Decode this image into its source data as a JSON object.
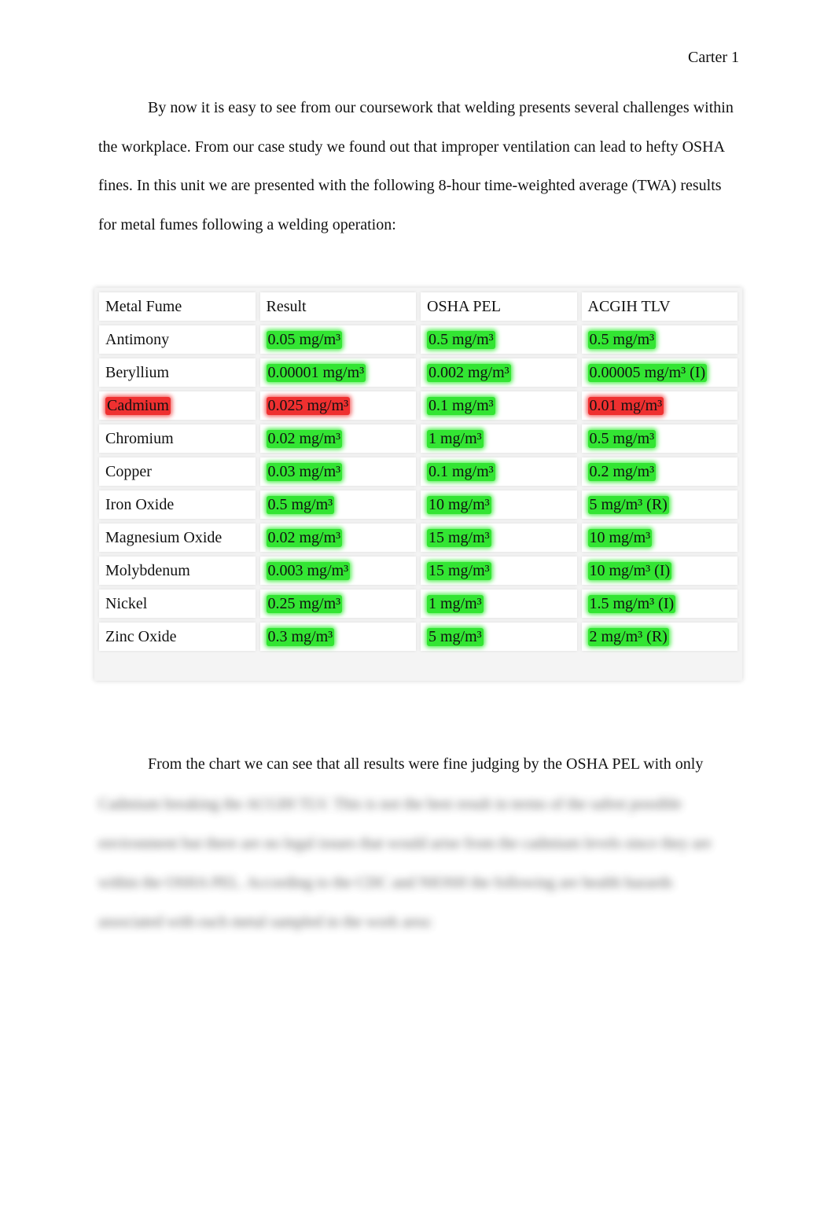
{
  "header": {
    "running_head": "Carter 1"
  },
  "paragraphs": {
    "intro": "By now it is easy to see from our coursework that welding presents several challenges within the workplace. From our case study we found out that improper ventilation can lead to hefty OSHA fines. In this unit we are presented with the following 8-hour time-weighted average (TWA) results for metal fumes following a welding operation:",
    "conclusion_start": "From the chart we can see that all results were fine judging by the OSHA PEL with only",
    "blurred_text": "Cadmium breaking the ACGIH TLV. This is not the best result in terms of the safest possible environment but there are no legal issues that would arise from the cadmium levels since they are within the OSHA PEL. According to the CDC and NIOSH the following are health hazards associated with each metal sampled in the work area:"
  },
  "table": {
    "columns": [
      "Metal Fume",
      "Result",
      "OSHA PEL",
      "ACGIH TLV"
    ],
    "status_colors": {
      "ok": "#33e533",
      "exceeds": "#ef3030"
    },
    "rows": [
      {
        "metal": "Antimony",
        "result": "0.05 mg/m³",
        "osha_pel": "0.5 mg/m³",
        "acgih_tlv": "0.5 mg/m³",
        "status": "ok"
      },
      {
        "metal": "Beryllium",
        "result": "0.00001 mg/m³",
        "osha_pel": "0.002 mg/m³",
        "acgih_tlv": "0.00005 mg/m³ (I)",
        "status": "ok"
      },
      {
        "metal": "Cadmium",
        "result": "0.025 mg/m³",
        "osha_pel": "0.1 mg/m³",
        "acgih_tlv": "0.01 mg/m³",
        "status": "exceeds"
      },
      {
        "metal": "Chromium",
        "result": "0.02 mg/m³",
        "osha_pel": "1 mg/m³",
        "acgih_tlv": "0.5 mg/m³",
        "status": "ok"
      },
      {
        "metal": "Copper",
        "result": "0.03 mg/m³",
        "osha_pel": "0.1 mg/m³",
        "acgih_tlv": "0.2 mg/m³",
        "status": "ok"
      },
      {
        "metal": "Iron Oxide",
        "result": "0.5 mg/m³",
        "osha_pel": "10 mg/m³",
        "acgih_tlv": "5 mg/m³ (R)",
        "status": "ok"
      },
      {
        "metal": "Magnesium Oxide",
        "result": "0.02 mg/m³",
        "osha_pel": "15 mg/m³",
        "acgih_tlv": "10 mg/m³",
        "status": "ok"
      },
      {
        "metal": "Molybdenum",
        "result": "0.003 mg/m³",
        "osha_pel": "15 mg/m³",
        "acgih_tlv": "10 mg/m³ (I)",
        "status": "ok"
      },
      {
        "metal": "Nickel",
        "result": "0.25 mg/m³",
        "osha_pel": "1 mg/m³",
        "acgih_tlv": "1.5 mg/m³ (I)",
        "status": "ok"
      },
      {
        "metal": "Zinc Oxide",
        "result": "0.3 mg/m³",
        "osha_pel": "5 mg/m³",
        "acgih_tlv": "2 mg/m³ (R)",
        "status": "ok"
      }
    ]
  }
}
